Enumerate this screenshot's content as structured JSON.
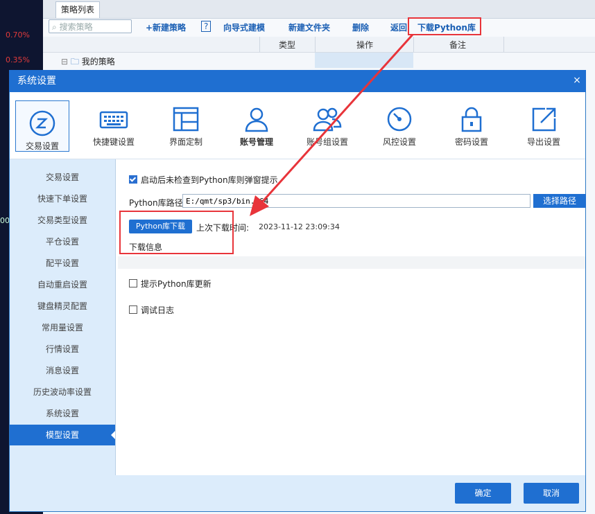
{
  "background": {
    "left_values": [
      "0.70%",
      "0.35%",
      "00"
    ],
    "tab": "策略列表",
    "search_placeholder": "搜索策略",
    "toolbar": {
      "new_strategy": "+新建策略",
      "help": "?",
      "wizard": "向导式建模",
      "new_folder": "新建文件夹",
      "delete": "删除",
      "back": "返回",
      "download_python": "下载Python库"
    },
    "columns": [
      "类型",
      "操作",
      "备注"
    ],
    "tree_root": "我的策略"
  },
  "dialog": {
    "title": "系统设置",
    "close": "×",
    "top_tabs": [
      {
        "label": "交易设置",
        "icon": "trade-settings-icon"
      },
      {
        "label": "快捷键设置",
        "icon": "keyboard-icon"
      },
      {
        "label": "界面定制",
        "icon": "layout-icon"
      },
      {
        "label": "账号管理",
        "icon": "user-icon"
      },
      {
        "label": "账号组设置",
        "icon": "user-group-icon"
      },
      {
        "label": "风控设置",
        "icon": "gauge-icon"
      },
      {
        "label": "密码设置",
        "icon": "lock-icon"
      },
      {
        "label": "导出设置",
        "icon": "export-icon"
      }
    ],
    "sidebar": [
      "交易设置",
      "快速下单设置",
      "交易类型设置",
      "平仓设置",
      "配平设置",
      "自动重启设置",
      "键盘精灵配置",
      "常用量设置",
      "行情设置",
      "消息设置",
      "历史波动率设置",
      "系统设置",
      "模型设置"
    ],
    "content": {
      "auto_check_label": "启动后未检查到Python库则弹窗提示",
      "auto_check_checked": true,
      "path_label": "Python库路径",
      "path_value": "E:/qmt/sp3/bin.x64",
      "choose_path": "选择路径",
      "download_button": "Python库下载",
      "last_download_label": "上次下载时间:",
      "last_download_value": "2023-11-12 23:09:34",
      "info_label": "下载信息",
      "update_label": "提示Python库更新",
      "update_checked": false,
      "debug_label": "调试日志",
      "debug_checked": false
    },
    "footer": {
      "ok": "确定",
      "cancel": "取消"
    }
  },
  "colors": {
    "accent": "#1f6fd1",
    "highlight": "#e8343a",
    "sidebar_bg": "#dcecfb"
  }
}
